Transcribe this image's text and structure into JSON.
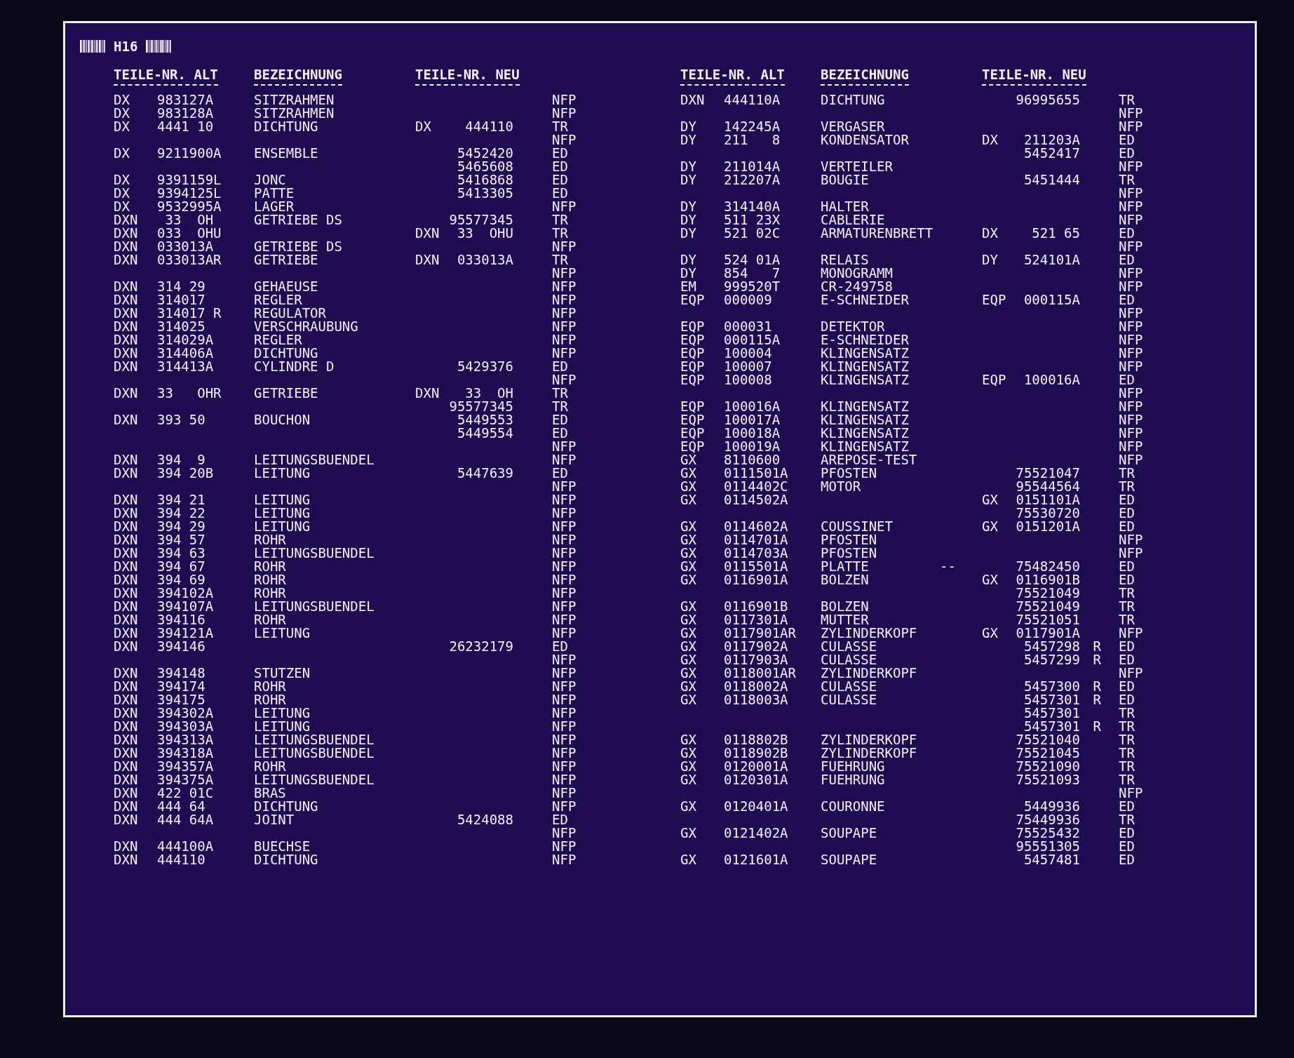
{
  "sheet": {
    "code": "H16"
  },
  "tables": [
    {
      "columns": {
        "alt": "TEILE-NR. ALT",
        "desc": "BEZEICHNUNG",
        "new": "TEILE-NR. NEU"
      },
      "rows": [
        {
          "alt_pre": "DX",
          "alt_no": "983127A",
          "desc": "SITZRAHMEN",
          "code": "NFP"
        },
        {
          "alt_pre": "DX",
          "alt_no": "983128A",
          "desc": "SITZRAHMEN",
          "code": "NFP"
        },
        {
          "alt_pre": "DX",
          "alt_no": "4441 10",
          "desc": "DICHTUNG",
          "new_pre": "DX",
          "new_no": "444110",
          "code": "TR"
        },
        {
          "code": "NFP"
        },
        {
          "alt_pre": "DX",
          "alt_no": "9211900A",
          "desc": "ENSEMBLE",
          "new_no": "5452420",
          "code": "ED"
        },
        {
          "new_no": "5465608",
          "code": "ED"
        },
        {
          "alt_pre": "DX",
          "alt_no": "9391159L",
          "desc": "JONC",
          "new_no": "5416868",
          "code": "ED"
        },
        {
          "alt_pre": "DX",
          "alt_no": "9394125L",
          "desc": "PATTE",
          "new_no": "5413305",
          "code": "ED"
        },
        {
          "alt_pre": "DX",
          "alt_no": "9532995A",
          "desc": "LAGER",
          "code": "NFP"
        },
        {
          "alt_pre": "DXN",
          "alt_no": " 33  OH",
          "desc": "GETRIEBE DS",
          "new_no": "95577345",
          "code": "TR"
        },
        {
          "alt_pre": "DXN",
          "alt_no": "033  OHU",
          "new_pre": "DXN",
          "new_no": "33  OHU",
          "code": "TR"
        },
        {
          "alt_pre": "DXN",
          "alt_no": "033013A",
          "desc": "GETRIEBE DS",
          "code": "NFP"
        },
        {
          "alt_pre": "DXN",
          "alt_no": "033013AR",
          "desc": "GETRIEBE",
          "new_pre": "DXN",
          "new_no": "033013A",
          "code": "TR"
        },
        {
          "code": "NFP"
        },
        {
          "alt_pre": "DXN",
          "alt_no": "314 29",
          "desc": "GEHAEUSE",
          "code": "NFP"
        },
        {
          "alt_pre": "DXN",
          "alt_no": "314017",
          "desc": "REGLER",
          "code": "NFP"
        },
        {
          "alt_pre": "DXN",
          "alt_no": "314017 R",
          "desc": "REGULATOR",
          "code": "NFP"
        },
        {
          "alt_pre": "DXN",
          "alt_no": "314025",
          "desc": "VERSCHRAUBUNG",
          "code": "NFP"
        },
        {
          "alt_pre": "DXN",
          "alt_no": "314029A",
          "desc": "REGLER",
          "code": "NFP"
        },
        {
          "alt_pre": "DXN",
          "alt_no": "314406A",
          "desc": "DICHTUNG",
          "code": "NFP"
        },
        {
          "alt_pre": "DXN",
          "alt_no": "314413A",
          "desc": "CYLINDRE D",
          "new_no": "5429376",
          "code": "ED"
        },
        {
          "code": "NFP"
        },
        {
          "alt_pre": "DXN",
          "alt_no": "33   OHR",
          "desc": "GETRIEBE",
          "new_pre": "DXN",
          "new_no": "33  OH",
          "code": "TR"
        },
        {
          "new_no": "95577345",
          "code": "TR"
        },
        {
          "alt_pre": "DXN",
          "alt_no": "393 50",
          "desc": "BOUCHON",
          "new_no": "5449553",
          "code": "ED"
        },
        {
          "new_no": "5449554",
          "code": "ED"
        },
        {
          "code": "NFP"
        },
        {
          "alt_pre": "DXN",
          "alt_no": "394  9",
          "desc": "LEITUNGSBUENDEL",
          "code": "NFP"
        },
        {
          "alt_pre": "DXN",
          "alt_no": "394 20B",
          "desc": "LEITUNG",
          "new_no": "5447639",
          "code": "ED"
        },
        {
          "code": "NFP"
        },
        {
          "alt_pre": "DXN",
          "alt_no": "394 21",
          "desc": "LEITUNG",
          "code": "NFP"
        },
        {
          "alt_pre": "DXN",
          "alt_no": "394 22",
          "desc": "LEITUNG",
          "code": "NFP"
        },
        {
          "alt_pre": "DXN",
          "alt_no": "394 29",
          "desc": "LEITUNG",
          "code": "NFP"
        },
        {
          "alt_pre": "DXN",
          "alt_no": "394 57",
          "desc": "ROHR",
          "code": "NFP"
        },
        {
          "alt_pre": "DXN",
          "alt_no": "394 63",
          "desc": "LEITUNGSBUENDEL",
          "code": "NFP"
        },
        {
          "alt_pre": "DXN",
          "alt_no": "394 67",
          "desc": "ROHR",
          "code": "NFP"
        },
        {
          "alt_pre": "DXN",
          "alt_no": "394 69",
          "desc": "ROHR",
          "code": "NFP"
        },
        {
          "alt_pre": "DXN",
          "alt_no": "394102A",
          "desc": "ROHR",
          "code": "NFP"
        },
        {
          "alt_pre": "DXN",
          "alt_no": "394107A",
          "desc": "LEITUNGSBUENDEL",
          "code": "NFP"
        },
        {
          "alt_pre": "DXN",
          "alt_no": "394116",
          "desc": "ROHR",
          "code": "NFP"
        },
        {
          "alt_pre": "DXN",
          "alt_no": "394121A",
          "desc": "LEITUNG",
          "code": "NFP"
        },
        {
          "alt_pre": "DXN",
          "alt_no": "394146",
          "new_no": "26232179",
          "code": "ED"
        },
        {
          "code": "NFP"
        },
        {
          "alt_pre": "DXN",
          "alt_no": "394148",
          "desc": "STUTZEN",
          "code": "NFP"
        },
        {
          "alt_pre": "DXN",
          "alt_no": "394174",
          "desc": "ROHR",
          "code": "NFP"
        },
        {
          "alt_pre": "DXN",
          "alt_no": "394175",
          "desc": "ROHR",
          "code": "NFP"
        },
        {
          "alt_pre": "DXN",
          "alt_no": "394302A",
          "desc": "LEITUNG",
          "code": "NFP"
        },
        {
          "alt_pre": "DXN",
          "alt_no": "394303A",
          "desc": "LEITUNG",
          "code": "NFP"
        },
        {
          "alt_pre": "DXN",
          "alt_no": "394313A",
          "desc": "LEITUNGSBUENDEL",
          "code": "NFP"
        },
        {
          "alt_pre": "DXN",
          "alt_no": "394318A",
          "desc": "LEITUNGSBUENDEL",
          "code": "NFP"
        },
        {
          "alt_pre": "DXN",
          "alt_no": "394357A",
          "desc": "ROHR",
          "code": "NFP"
        },
        {
          "alt_pre": "DXN",
          "alt_no": "394375A",
          "desc": "LEITUNGSBUENDEL",
          "code": "NFP"
        },
        {
          "alt_pre": "DXN",
          "alt_no": "422 01C",
          "desc": "BRAS",
          "code": "NFP"
        },
        {
          "alt_pre": "DXN",
          "alt_no": "444 64",
          "desc": "DICHTUNG",
          "code": "NFP"
        },
        {
          "alt_pre": "DXN",
          "alt_no": "444 64A",
          "desc": "JOINT",
          "new_no": "5424088",
          "code": "ED"
        },
        {
          "code": "NFP"
        },
        {
          "alt_pre": "DXN",
          "alt_no": "444100A",
          "desc": "BUECHSE",
          "code": "NFP"
        },
        {
          "alt_pre": "DXN",
          "alt_no": "444110",
          "desc": "DICHTUNG",
          "code": "NFP"
        }
      ]
    },
    {
      "columns": {
        "alt": "TEILE-NR. ALT",
        "desc": "BEZEICHNUNG",
        "new": "TEILE-NR. NEU"
      },
      "rows": [
        {
          "alt_pre": "DXN",
          "alt_no": "444110A",
          "desc": "DICHTUNG",
          "new_no": "96995655",
          "code": "TR"
        },
        {
          "code": "NFP"
        },
        {
          "alt_pre": "DY",
          "alt_no": "142245A",
          "desc": "VERGASER",
          "code": "NFP"
        },
        {
          "alt_pre": "DY",
          "alt_no": "211   8",
          "desc": "KONDENSATOR",
          "new_pre": "DX",
          "new_no": "211203A",
          "code": "ED"
        },
        {
          "new_no": "5452417",
          "code": "ED"
        },
        {
          "alt_pre": "DY",
          "alt_no": "211014A",
          "desc": "VERTEILER",
          "code": "NFP"
        },
        {
          "alt_pre": "DY",
          "alt_no": "212207A",
          "desc": "BOUGIE",
          "new_no": "5451444",
          "code": "TR"
        },
        {
          "code": "NFP"
        },
        {
          "alt_pre": "DY",
          "alt_no": "314140A",
          "desc": "HALTER",
          "code": "NFP"
        },
        {
          "alt_pre": "DY",
          "alt_no": "511 23X",
          "desc": "CABLERIE",
          "code": "NFP"
        },
        {
          "alt_pre": "DY",
          "alt_no": "521 02C",
          "desc": "ARMATURENBRETT",
          "new_pre": "DX",
          "new_no": "521 65",
          "code": "ED"
        },
        {
          "code": "NFP"
        },
        {
          "alt_pre": "DY",
          "alt_no": "524 01A",
          "desc": "RELAIS",
          "new_pre": "DY",
          "new_no": "524101A",
          "code": "ED"
        },
        {
          "alt_pre": "DY",
          "alt_no": "854   7",
          "desc": "MONOGRAMM",
          "code": "NFP"
        },
        {
          "alt_pre": "EM",
          "alt_no": "999520T",
          "desc": "CR-249758",
          "code": "NFP"
        },
        {
          "alt_pre": "EQP",
          "alt_no": "000009",
          "desc": "E-SCHNEIDER",
          "new_pre": "EQP",
          "new_no": "000115A",
          "code": "ED"
        },
        {
          "code": "NFP"
        },
        {
          "alt_pre": "EQP",
          "alt_no": "000031",
          "desc": "DETEKTOR",
          "code": "NFP"
        },
        {
          "alt_pre": "EQP",
          "alt_no": "000115A",
          "desc": "E-SCHNEIDER",
          "code": "NFP"
        },
        {
          "alt_pre": "EQP",
          "alt_no": "100004",
          "desc": "KLINGENSATZ",
          "code": "NFP"
        },
        {
          "alt_pre": "EQP",
          "alt_no": "100007",
          "desc": "KLINGENSATZ",
          "code": "NFP"
        },
        {
          "alt_pre": "EQP",
          "alt_no": "100008",
          "desc": "KLINGENSATZ",
          "new_pre": "EQP",
          "new_no": "100016A",
          "code": "ED"
        },
        {
          "code": "NFP"
        },
        {
          "alt_pre": "EQP",
          "alt_no": "100016A",
          "desc": "KLINGENSATZ",
          "code": "NFP"
        },
        {
          "alt_pre": "EQP",
          "alt_no": "100017A",
          "desc": "KLINGENSATZ",
          "code": "NFP"
        },
        {
          "alt_pre": "EQP",
          "alt_no": "100018A",
          "desc": "KLINGENSATZ",
          "code": "NFP"
        },
        {
          "alt_pre": "EQP",
          "alt_no": "100019A",
          "desc": "KLINGENSATZ",
          "code": "NFP"
        },
        {
          "alt_pre": "GX",
          "alt_no": "8110600",
          "desc": "AREPOSE-TEST",
          "code": "NFP"
        },
        {
          "alt_pre": "GX",
          "alt_no": "0111501A",
          "desc": "PFOSTEN",
          "new_no": "75521047",
          "code": "TR"
        },
        {
          "alt_pre": "GX",
          "alt_no": "0114402C",
          "desc": "MOTOR",
          "new_no": "95544564",
          "code": "TR"
        },
        {
          "alt_pre": "GX",
          "alt_no": "0114502A",
          "new_pre": "GX",
          "new_no": "0151101A",
          "code": "ED"
        },
        {
          "new_no": "75530720",
          "code": "ED"
        },
        {
          "alt_pre": "GX",
          "alt_no": "0114602A",
          "desc": "COUSSINET",
          "new_pre": "GX",
          "new_no": "0151201A",
          "code": "ED"
        },
        {
          "alt_pre": "GX",
          "alt_no": "0114701A",
          "desc": "PFOSTEN",
          "code": "NFP"
        },
        {
          "alt_pre": "GX",
          "alt_no": "0114703A",
          "desc": "PFOSTEN",
          "code": "NFP"
        },
        {
          "alt_pre": "GX",
          "alt_no": "0115501A",
          "desc": "PLATTE",
          "mark": "--",
          "new_no": "75482450",
          "code": "ED"
        },
        {
          "alt_pre": "GX",
          "alt_no": "0116901A",
          "desc": "BOLZEN",
          "new_pre": "GX",
          "new_no": "0116901B",
          "code": "ED"
        },
        {
          "new_no": "75521049",
          "code": "TR"
        },
        {
          "alt_pre": "GX",
          "alt_no": "0116901B",
          "desc": "BOLZEN",
          "new_no": "75521049",
          "code": "TR"
        },
        {
          "alt_pre": "GX",
          "alt_no": "0117301A",
          "desc": "MUTTER",
          "new_no": "75521051",
          "code": "TR"
        },
        {
          "alt_pre": "GX",
          "alt_no": "0117901AR",
          "desc": "ZYLINDERKOPF",
          "new_pre": "GX",
          "new_no": "0117901A",
          "code": "NFP"
        },
        {
          "alt_pre": "GX",
          "alt_no": "0117902A",
          "desc": "CULASSE",
          "new_no": "5457298",
          "new_sfx": "R",
          "code": "ED"
        },
        {
          "alt_pre": "GX",
          "alt_no": "0117903A",
          "desc": "CULASSE",
          "new_no": "5457299",
          "new_sfx": "R",
          "code": "ED"
        },
        {
          "alt_pre": "GX",
          "alt_no": "0118001AR",
          "desc": "ZYLINDERKOPF",
          "code": "NFP"
        },
        {
          "alt_pre": "GX",
          "alt_no": "0118002A",
          "desc": "CULASSE",
          "new_no": "5457300",
          "new_sfx": "R",
          "code": "ED"
        },
        {
          "alt_pre": "GX",
          "alt_no": "0118003A",
          "desc": "CULASSE",
          "new_no": "5457301",
          "new_sfx": "R",
          "code": "ED"
        },
        {
          "new_no": "5457301",
          "code": "TR"
        },
        {
          "new_no": "5457301",
          "new_sfx": "R",
          "code": "TR"
        },
        {
          "alt_pre": "GX",
          "alt_no": "0118802B",
          "desc": "ZYLINDERKOPF",
          "new_no": "75521040",
          "code": "TR"
        },
        {
          "alt_pre": "GX",
          "alt_no": "0118902B",
          "desc": "ZYLINDERKOPF",
          "new_no": "75521045",
          "code": "TR"
        },
        {
          "alt_pre": "GX",
          "alt_no": "0120001A",
          "desc": "FUEHRUNG",
          "new_no": "75521090",
          "code": "TR"
        },
        {
          "alt_pre": "GX",
          "alt_no": "0120301A",
          "desc": "FUEHRUNG",
          "new_no": "75521093",
          "code": "TR"
        },
        {
          "code": "NFP"
        },
        {
          "alt_pre": "GX",
          "alt_no": "0120401A",
          "desc": "COURONNE",
          "new_no": "5449936",
          "code": "ED"
        },
        {
          "new_no": "75449936",
          "code": "TR"
        },
        {
          "alt_pre": "GX",
          "alt_no": "0121402A",
          "desc": "SOUPAPE",
          "new_no": "75525432",
          "code": "ED"
        },
        {
          "new_no": "95551305",
          "code": "ED"
        },
        {
          "alt_pre": "GX",
          "alt_no": "0121601A",
          "desc": "SOUPAPE",
          "new_no": "5457481",
          "code": "ED"
        }
      ]
    }
  ]
}
